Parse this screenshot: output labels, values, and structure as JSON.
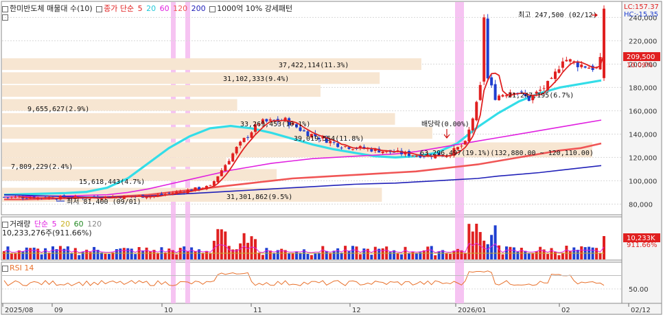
{
  "colors": {
    "up": "#e02020",
    "down": "#1f3fd0",
    "ma5": "#e02020",
    "ma20": "#33dde8",
    "ma60": "#e020e0",
    "ma120": "#f05555",
    "ma200": "#2020b8",
    "band": "#f7e6d2",
    "highlight": "#f4b8f0",
    "rsi": "#e8702a",
    "grid": "#d8d8d8"
  },
  "header": {
    "title": "한미반도체 매물대 수(10)",
    "ma_label": "종가 단순",
    "ma_periods": [
      "5",
      "20",
      "60",
      "120",
      "200"
    ],
    "extra": "1000억 10% 강세패턴",
    "lc": "LC:157.37",
    "hc": "HC:-15.35"
  },
  "volume_header": {
    "title": "거래량",
    "ma_label": "단순",
    "ma_periods": [
      "5",
      "20",
      "60",
      "120"
    ],
    "value": "10,233,276주(911.66%)"
  },
  "rsi_header": {
    "title": "RSI 14"
  },
  "right_badges": {
    "price": "209,500",
    "price_pct": "10.09%",
    "volume": "10,233K",
    "volume_pct": "911.66%"
  },
  "annotations": {
    "high": "최고 247,500 (02/12)",
    "low": "최저 81,400 (09/01)",
    "dividend": "배당락(0.00%)"
  },
  "chart_data": {
    "type": "candlestick",
    "x_labels": [
      "2025/08",
      "09",
      "10",
      "11",
      "12",
      "2026/01",
      "02",
      "02/12"
    ],
    "y_ticks": [
      "240,000",
      "220,000",
      "200,000",
      "180,000",
      "160,000",
      "140,000",
      "120,000",
      "100,000",
      "80,000"
    ],
    "ylim": [
      72000,
      252000
    ],
    "rsi_tick": "50.00",
    "last_close": 209500,
    "high": 247500,
    "low": 81400,
    "volume_profile": [
      {
        "label": "37,422,114(11.3%)",
        "price_low": 195000,
        "price_high": 205000,
        "share": 11.3
      },
      {
        "label": "31,102,333(9.4%)",
        "price_low": 183000,
        "price_high": 193000,
        "share": 9.4
      },
      {
        "label": "21,247,195(6.7%)",
        "price_low": 172000,
        "price_high": 182000,
        "share": 6.7
      },
      {
        "label": "9,655,627(2.9%)",
        "price_low": 160000,
        "price_high": 170000,
        "share": 2.9
      },
      {
        "label": "33,269,453(10.1%)",
        "price_low": 148000,
        "price_high": 158000,
        "share": 10.1
      },
      {
        "label": "39,019,554(11.8%)",
        "price_low": 136000,
        "price_high": 146000,
        "share": 11.8
      },
      {
        "label": "63,296,497(19.1%)(132,880.00 ~ 120,110.00)",
        "price_low": 120110,
        "price_high": 132880,
        "share": 19.1
      },
      {
        "label": "7,809,229(2.4%)",
        "price_low": 112000,
        "price_high": 120000,
        "share": 2.4
      },
      {
        "label": "15,618,443(4.7%)",
        "price_low": 100000,
        "price_high": 110000,
        "share": 4.7
      },
      {
        "label": "31,301,862(9.5%)",
        "price_low": 82000,
        "price_high": 94000,
        "share": 9.5
      }
    ],
    "ma_lines": [
      {
        "name": "20",
        "values": [
          88000,
          88500,
          89000,
          89500,
          90500,
          94000,
          102000,
          115000,
          128000,
          138000,
          145000,
          147000,
          145000,
          141000,
          136000,
          131000,
          127000,
          124000,
          121000,
          120000,
          121000,
          124000,
          132000,
          146000,
          158000,
          168000,
          175000,
          180000,
          183000,
          186000
        ]
      },
      {
        "name": "60",
        "values": [
          86000,
          86500,
          87000,
          87000,
          87500,
          88000,
          90000,
          93000,
          97000,
          101000,
          105000,
          109000,
          112000,
          115000,
          117000,
          119000,
          120000,
          121000,
          122000,
          123000,
          125000,
          128000,
          131000,
          134000,
          137000,
          140000,
          143000,
          146000,
          149000,
          152000
        ]
      },
      {
        "name": "120",
        "values": [
          84000,
          84000,
          84500,
          85000,
          85500,
          86000,
          87000,
          88000,
          90000,
          92000,
          94000,
          96000,
          98000,
          100000,
          102000,
          103000,
          104000,
          105000,
          106000,
          107000,
          108000,
          110000,
          112000,
          114000,
          117000,
          120000,
          123000,
          126000,
          128000,
          132000
        ]
      },
      {
        "name": "200",
        "values": [
          88000,
          87500,
          87000,
          86500,
          86000,
          86000,
          86500,
          87000,
          88000,
          89000,
          90000,
          91000,
          92000,
          93000,
          94000,
          95000,
          96000,
          97000,
          97500,
          98000,
          99000,
          100000,
          101000,
          102000,
          104000,
          105500,
          107000,
          109000,
          111000,
          113000
        ]
      }
    ]
  }
}
